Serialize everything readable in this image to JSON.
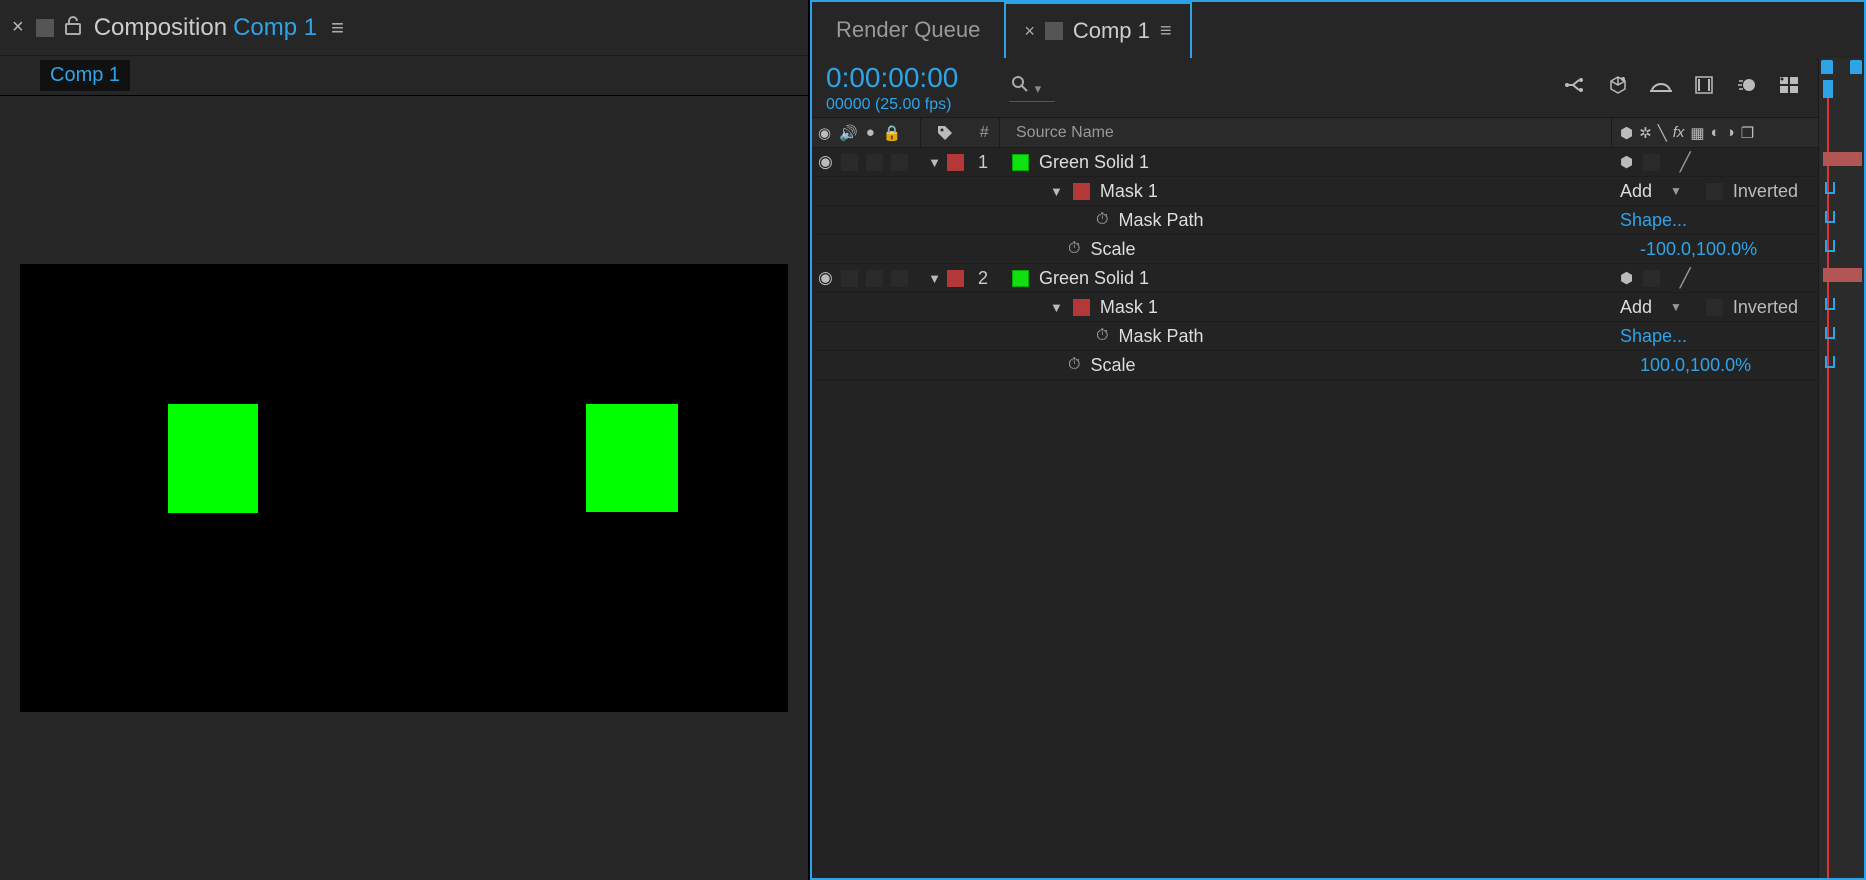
{
  "comp_panel": {
    "title_static": "Composition",
    "title_comp": "Comp 1",
    "breadcrumb": "Comp 1"
  },
  "timeline_panel": {
    "tabs": {
      "inactive": "Render Queue",
      "active": "Comp 1"
    },
    "timecode": "0:00:00:00",
    "frame_info": "00000 (25.00 fps)",
    "columns": {
      "source_name": "Source Name"
    },
    "layers": [
      {
        "index": "1",
        "name": "Green Solid 1",
        "mask": {
          "name": "Mask 1",
          "mode": "Add",
          "inverted_label": "Inverted",
          "path_label": "Mask Path",
          "path_value": "Shape..."
        },
        "scale": {
          "label": "Scale",
          "value": "-100.0,100.0%"
        }
      },
      {
        "index": "2",
        "name": "Green Solid 1",
        "mask": {
          "name": "Mask 1",
          "mode": "Add",
          "inverted_label": "Inverted",
          "path_label": "Mask Path",
          "path_value": "Shape..."
        },
        "scale": {
          "label": "Scale",
          "value": "100.0,100.0%"
        }
      }
    ]
  }
}
